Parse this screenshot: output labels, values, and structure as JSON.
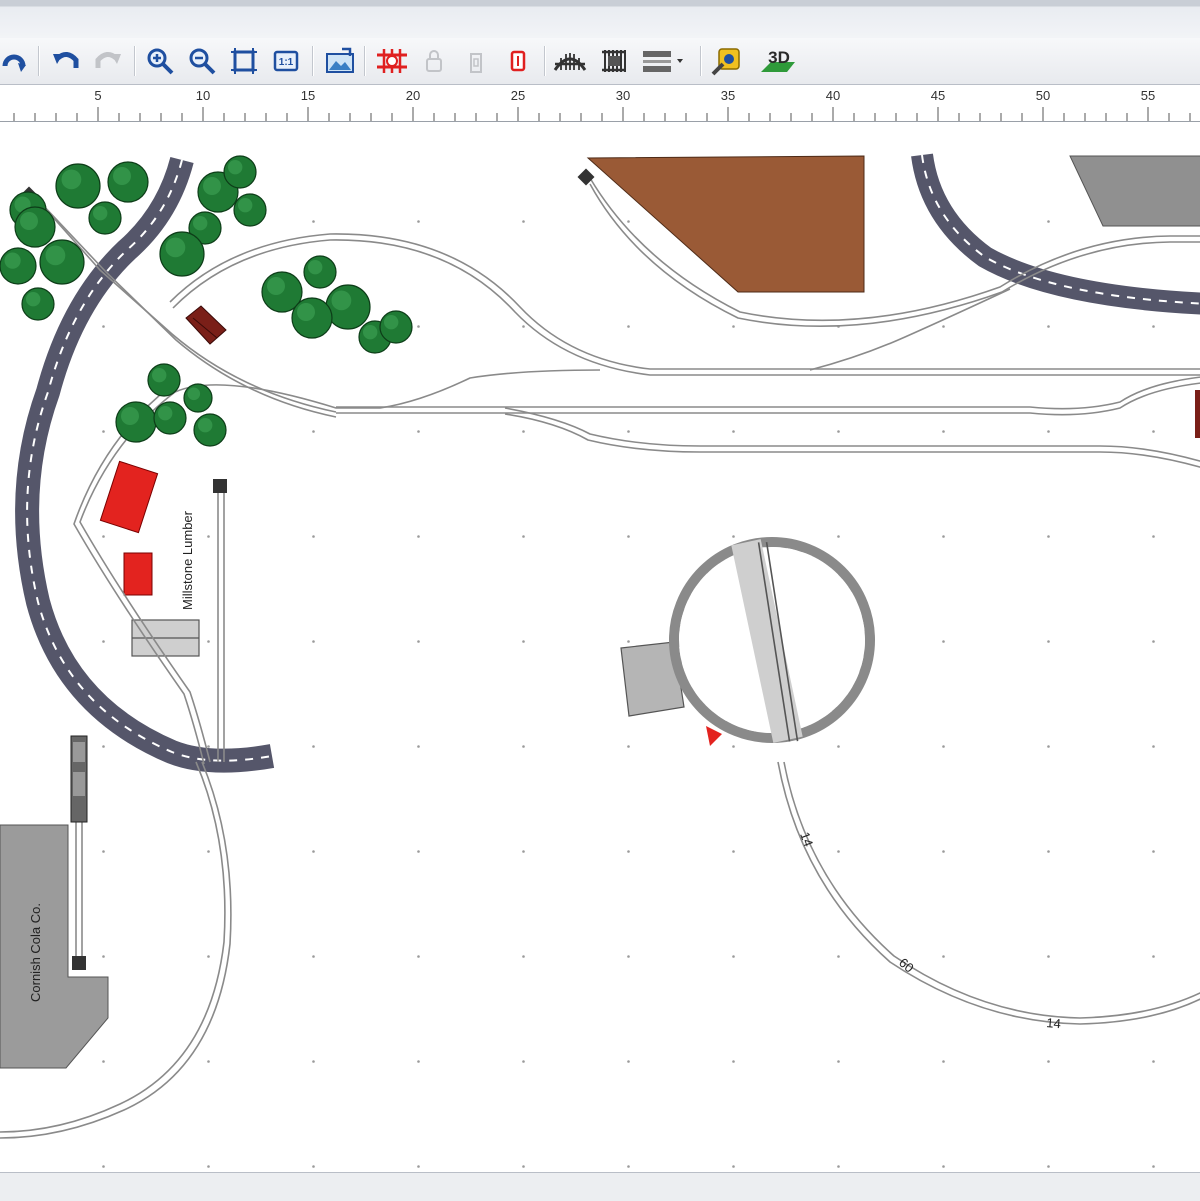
{
  "toolbar": {
    "buttons": [
      {
        "name": "redo-arrow-icon"
      },
      {
        "name": "undo-icon"
      },
      {
        "name": "redo-icon",
        "state": "disabled"
      },
      {
        "name": "zoom-in-icon"
      },
      {
        "name": "zoom-out-icon"
      },
      {
        "name": "zoom-fit-icon"
      },
      {
        "name": "zoom-actual-size-icon",
        "label": "1:1"
      },
      {
        "name": "background-image-icon"
      },
      {
        "name": "delete-track-icon"
      },
      {
        "name": "lock-icon",
        "state": "disabled"
      },
      {
        "name": "unlock-icon",
        "state": "disabled"
      },
      {
        "name": "flex-track-icon"
      },
      {
        "name": "bridge-icon"
      },
      {
        "name": "tunnel-icon"
      },
      {
        "name": "track-layers-icon"
      },
      {
        "name": "parts-list-icon"
      },
      {
        "name": "3d-view-icon",
        "label": "3D"
      }
    ]
  },
  "ruler": {
    "labels": [
      "5",
      "10",
      "15",
      "20",
      "25",
      "30",
      "35",
      "40",
      "45",
      "50",
      "55"
    ]
  },
  "layout": {
    "labels": {
      "lumber": "Millstone Lumber",
      "cola": "Cornish Cola Co."
    },
    "track_marks": [
      "14",
      "60",
      "14"
    ],
    "colors": {
      "road": "#55566a",
      "rail": "#8a8a8a",
      "tree": "#1f7a34",
      "building_red": "#e3231f",
      "building_brown": "#9a5a36",
      "building_gray": "#9b9b9b",
      "depot": "#7a1f18"
    }
  }
}
